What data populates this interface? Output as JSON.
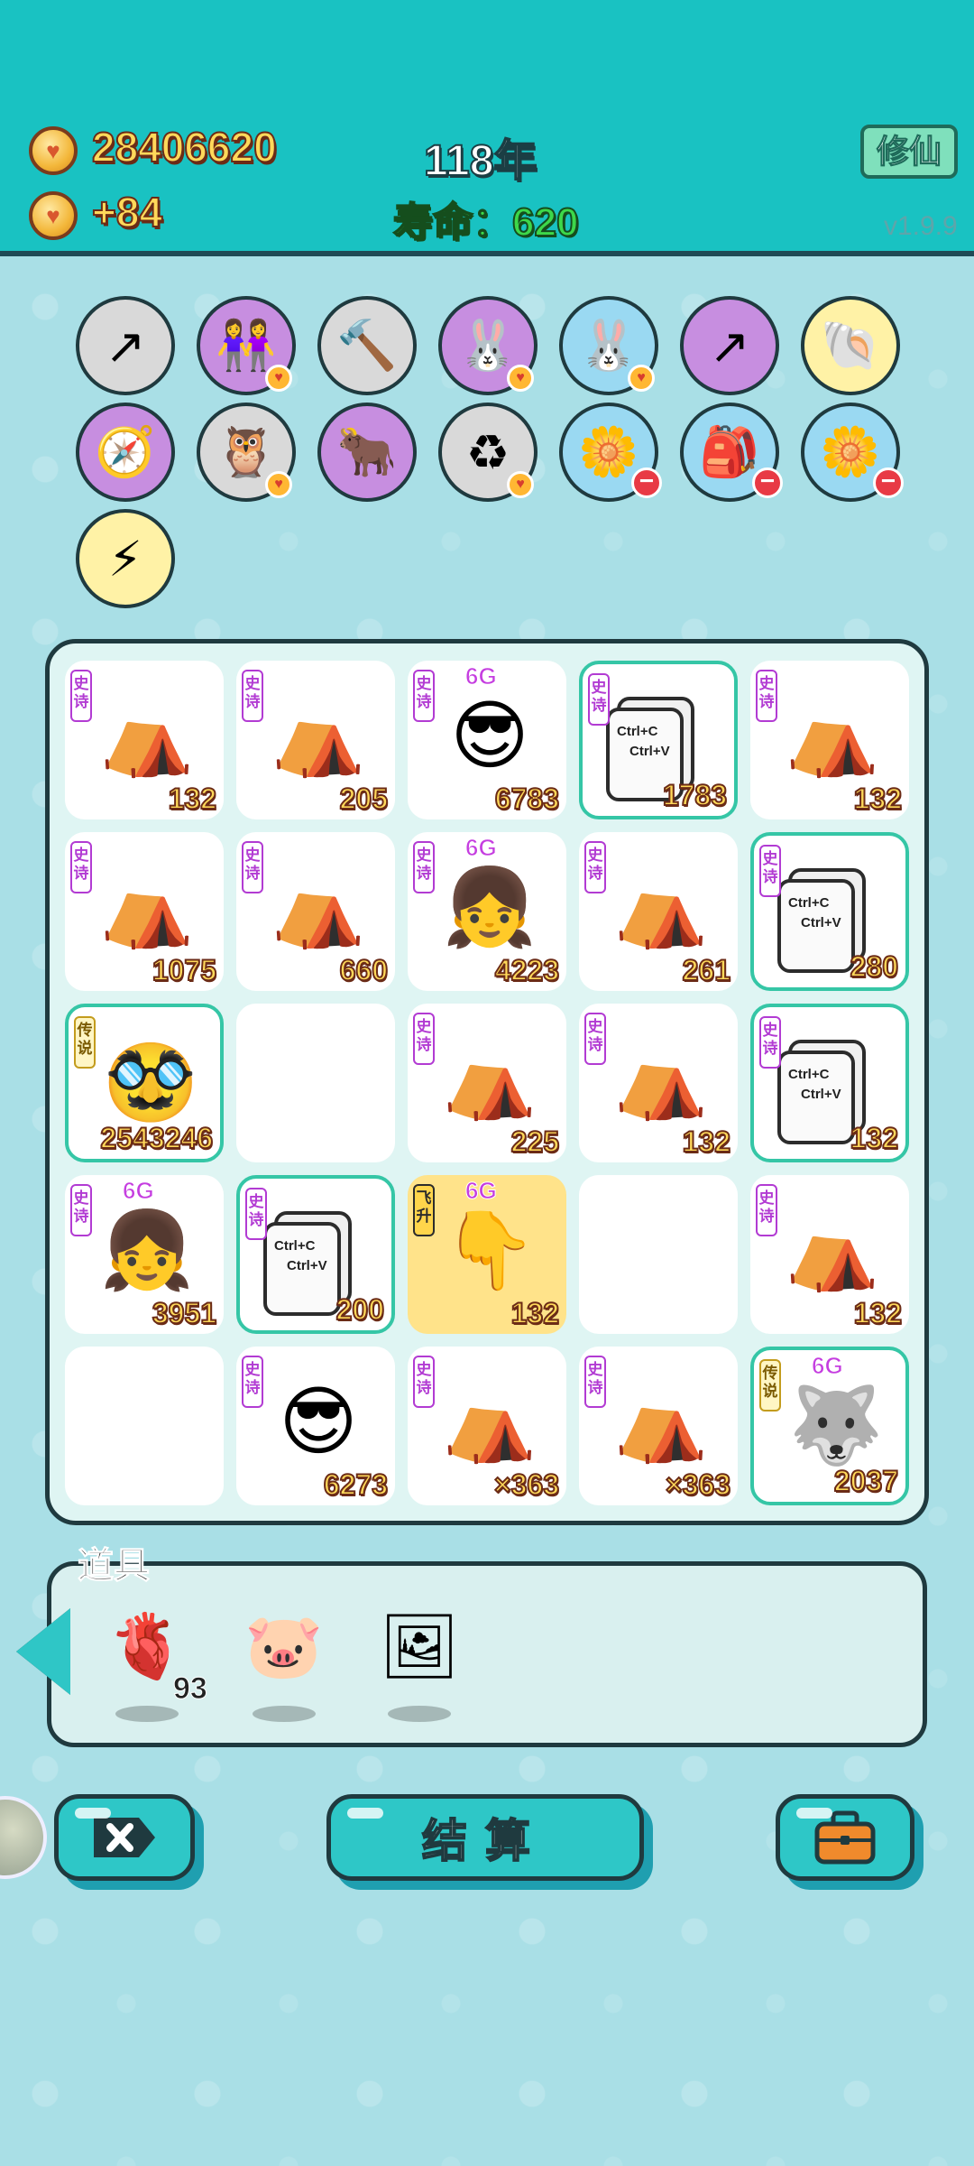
{
  "header": {
    "coins": "28406620",
    "income": "+84",
    "year": "118年",
    "lifespan": "寿命：620",
    "xiuxian_button": "修仙",
    "version": "v1.9.9"
  },
  "icons": [
    {
      "name": "arrow-card-icon",
      "glyph": "↗",
      "color": "grey"
    },
    {
      "name": "twins-icon",
      "glyph": "👭",
      "color": "purple",
      "badge": "heart"
    },
    {
      "name": "hammer-icon",
      "glyph": "🔨",
      "color": "grey"
    },
    {
      "name": "rabbit-icon",
      "glyph": "🐰",
      "color": "purple",
      "badge": "heart"
    },
    {
      "name": "rabbit-icon",
      "glyph": "🐰",
      "color": "blue",
      "badge": "heart"
    },
    {
      "name": "arrow-card-icon",
      "glyph": "↗",
      "color": "purple"
    },
    {
      "name": "shell-icon",
      "glyph": "🐚",
      "color": "yellow"
    },
    {
      "name": "compass-icon",
      "glyph": "🧭",
      "color": "purple"
    },
    {
      "name": "owl-icon",
      "glyph": "🦉",
      "color": "grey",
      "badge": "heart"
    },
    {
      "name": "ox-card-icon",
      "glyph": "🐂",
      "color": "purple"
    },
    {
      "name": "recycle-icon",
      "glyph": "♻",
      "color": "grey",
      "badge": "heart"
    },
    {
      "name": "flower-pot-icon",
      "glyph": "🌼",
      "color": "blue",
      "badge": "minus"
    },
    {
      "name": "bag-icon",
      "glyph": "🎒",
      "color": "blue",
      "badge": "minus"
    },
    {
      "name": "flower-pot-icon",
      "glyph": "🌼",
      "color": "blue",
      "badge": "minus"
    },
    {
      "name": "lightning-icon",
      "glyph": "⚡",
      "color": "yellow"
    }
  ],
  "board": {
    "cells": [
      {
        "type": "tent",
        "tag": "史诗",
        "num": "132"
      },
      {
        "type": "tent",
        "tag": "史诗",
        "num": "205"
      },
      {
        "type": "green-man",
        "tag": "史诗",
        "gen": "6G",
        "num": "6783"
      },
      {
        "type": "ctrl",
        "tag": "史诗",
        "num": "1783",
        "teal": true
      },
      {
        "type": "tent",
        "tag": "史诗",
        "num": "132"
      },
      {
        "type": "tent",
        "tag": "史诗",
        "num": "1075"
      },
      {
        "type": "tent",
        "tag": "史诗",
        "num": "660"
      },
      {
        "type": "girl",
        "tag": "史诗",
        "gen": "6G",
        "num": "4223"
      },
      {
        "type": "tent",
        "tag": "史诗",
        "num": "261"
      },
      {
        "type": "ctrl",
        "tag": "史诗",
        "num": "280",
        "teal": true
      },
      {
        "type": "old-man",
        "tag": "传说",
        "legend": true,
        "num": "2543246",
        "teal": true
      },
      {
        "type": "empty"
      },
      {
        "type": "tent",
        "tag": "史诗",
        "num": "225"
      },
      {
        "type": "tent",
        "tag": "史诗",
        "num": "132"
      },
      {
        "type": "ctrl",
        "tag": "史诗",
        "num": "132",
        "teal": true
      },
      {
        "type": "girl",
        "tag": "史诗",
        "gen": "6G",
        "num": "3951"
      },
      {
        "type": "ctrl",
        "tag": "史诗",
        "num": "200",
        "teal": true
      },
      {
        "type": "finger",
        "tag": "飞升",
        "fly": true,
        "gen": "6G",
        "num": "132",
        "gold": true
      },
      {
        "type": "empty"
      },
      {
        "type": "tent",
        "tag": "史诗",
        "num": "132"
      },
      {
        "type": "empty"
      },
      {
        "type": "green-man",
        "tag": "史诗",
        "num": "6273"
      },
      {
        "type": "tent",
        "tag": "史诗",
        "num": "×363"
      },
      {
        "type": "tent",
        "tag": "史诗",
        "num": "×363"
      },
      {
        "type": "husky",
        "tag": "传说",
        "legend": true,
        "gen": "6G",
        "num": "2037",
        "teal": true
      }
    ],
    "ctrl_text": [
      "Ctrl+C",
      "Ctrl+V"
    ]
  },
  "props": {
    "title": "道具",
    "items": [
      {
        "name": "liver-icon",
        "glyph": "🫀",
        "count": "93"
      },
      {
        "name": "piggy-bank-icon",
        "glyph": "🐷",
        "count": ""
      },
      {
        "name": "frame-icon",
        "glyph": "🖼",
        "count": ""
      }
    ]
  },
  "buttons": {
    "settle": "结算"
  },
  "colors": {
    "header_bg": "#19c2c2",
    "body_bg": "#a9dfe6",
    "number_gold": "#ffd95a",
    "epic_purple": "#b23bd3"
  }
}
